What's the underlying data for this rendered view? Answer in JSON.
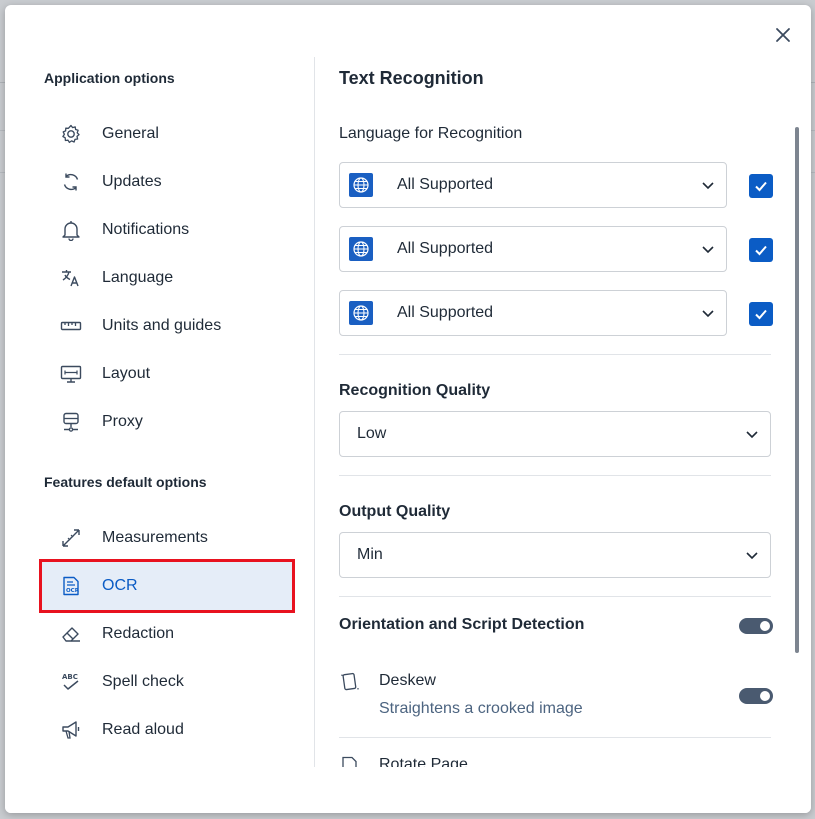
{
  "colors": {
    "accent": "#0b5cc5",
    "active_bg": "#e5edf8",
    "highlight_border": "#e8121f",
    "toggle_on": "#4a5a70"
  },
  "sidebar": {
    "app_section_title": "Application options",
    "app_items": [
      {
        "label": "General",
        "icon": "gear-icon"
      },
      {
        "label": "Updates",
        "icon": "refresh-icon"
      },
      {
        "label": "Notifications",
        "icon": "bell-icon"
      },
      {
        "label": "Language",
        "icon": "translate-icon"
      },
      {
        "label": "Units and guides",
        "icon": "ruler-icon"
      },
      {
        "label": "Layout",
        "icon": "monitor-icon"
      },
      {
        "label": "Proxy",
        "icon": "server-icon"
      }
    ],
    "feature_section_title": "Features default options",
    "feature_items": [
      {
        "label": "Measurements",
        "icon": "measure-arrows-icon"
      },
      {
        "label": "OCR",
        "icon": "ocr-icon",
        "active": true
      },
      {
        "label": "Redaction",
        "icon": "eraser-icon"
      },
      {
        "label": "Spell check",
        "icon": "spell-check-icon"
      },
      {
        "label": "Read aloud",
        "icon": "megaphone-icon"
      }
    ]
  },
  "content": {
    "title": "Text Recognition",
    "language_label": "Language for Recognition",
    "languages": [
      {
        "value": "All Supported",
        "checked": true
      },
      {
        "value": "All Supported",
        "checked": true
      },
      {
        "value": "All Supported",
        "checked": true
      }
    ],
    "recognition_quality_label": "Recognition Quality",
    "recognition_quality_value": "Low",
    "output_quality_label": "Output Quality",
    "output_quality_value": "Min",
    "osd_label": "Orientation and Script Detection",
    "osd_on": true,
    "deskew_label": "Deskew",
    "deskew_desc": "Straightens a crooked image",
    "deskew_on": true,
    "rotate_label": "Rotate Page"
  }
}
